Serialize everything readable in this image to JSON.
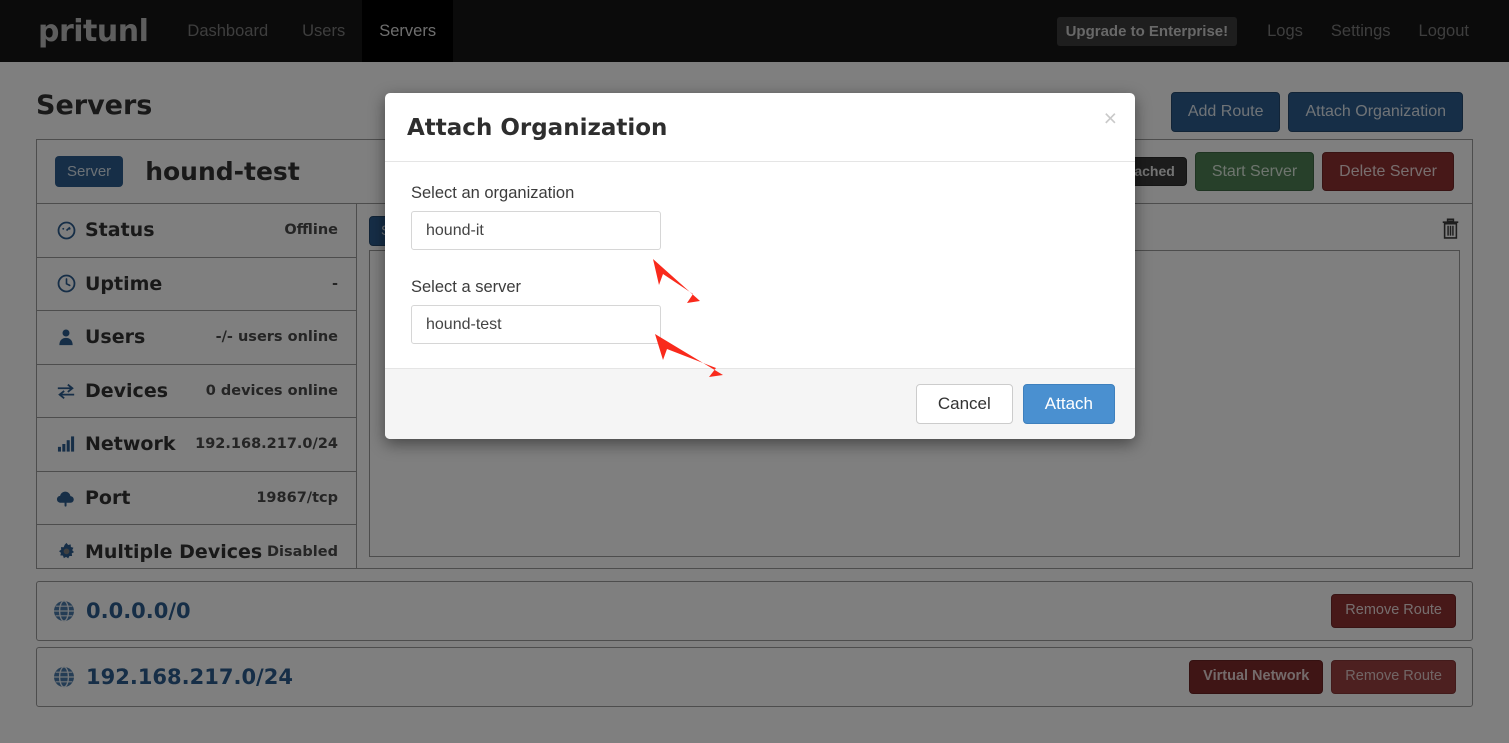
{
  "navbar": {
    "brand": "pritunl",
    "links": [
      {
        "label": "Dashboard",
        "active": false
      },
      {
        "label": "Users",
        "active": false
      },
      {
        "label": "Servers",
        "active": true
      }
    ],
    "upgrade_label": "Upgrade to Enterprise!",
    "right_links": [
      {
        "label": "Logs"
      },
      {
        "label": "Settings"
      },
      {
        "label": "Logout"
      }
    ]
  },
  "page": {
    "title": "Servers",
    "top_actions": [
      {
        "label": "Add Route",
        "style": "primary"
      },
      {
        "label": "Attach Organization",
        "style": "primary"
      }
    ]
  },
  "server": {
    "tag": "Server",
    "name": "hound-test",
    "head_actions": [
      {
        "label": "Detached",
        "style": "dark"
      },
      {
        "label": "Start Server",
        "style": "success"
      },
      {
        "label": "Delete Server",
        "style": "danger"
      }
    ],
    "info": [
      {
        "icon": "speedometer-icon",
        "label": "Status",
        "value": "Offline"
      },
      {
        "icon": "clock-icon",
        "label": "Uptime",
        "value": "-"
      },
      {
        "icon": "user-icon",
        "label": "Users",
        "value": "-/- users online"
      },
      {
        "icon": "exchange-icon",
        "label": "Devices",
        "value": "0 devices online"
      },
      {
        "icon": "signal-bars-icon",
        "label": "Network",
        "value": "192.168.217.0/24"
      },
      {
        "icon": "cloud-upload-icon",
        "label": "Port",
        "value": "19867/tcp"
      },
      {
        "icon": "gear-icon",
        "label": "Multiple Devices",
        "value": "Disabled"
      }
    ],
    "main_toolbar": {
      "partial_button_label": "S",
      "trash_icon": "trash-icon"
    }
  },
  "routes": [
    {
      "icon": "globe-icon",
      "network": "0.0.0.0/0",
      "actions": [
        {
          "label": "Remove Route",
          "style": "danger-solid"
        }
      ]
    },
    {
      "icon": "globe-icon",
      "network": "192.168.217.0/24",
      "actions": [
        {
          "label": "Virtual Network",
          "style": "vnet"
        },
        {
          "label": "Remove Route",
          "style": "danger-muted"
        }
      ]
    }
  ],
  "modal": {
    "title": "Attach Organization",
    "close_label": "×",
    "org_field": {
      "label": "Select an organization",
      "value": "hound-it"
    },
    "server_field": {
      "label": "Select a server",
      "value": "hound-test"
    },
    "cancel_label": "Cancel",
    "attach_label": "Attach"
  },
  "colors": {
    "navbar_bg": "#161616",
    "primary": "#2d5d8e",
    "accent_blue": "#4a90d0",
    "danger": "#8e3030",
    "success": "#4e8055",
    "annotation_arrow": "#f92a1c"
  }
}
